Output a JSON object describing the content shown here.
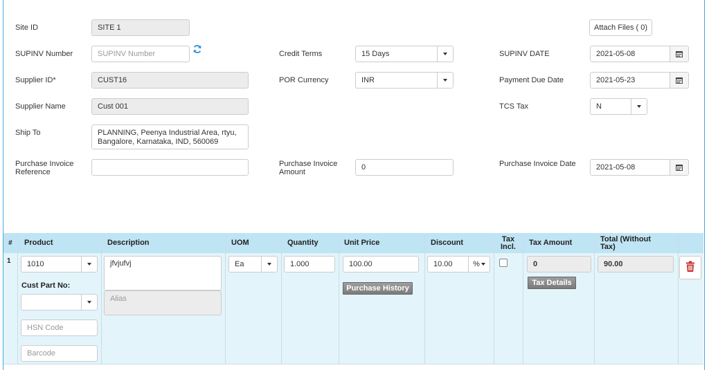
{
  "header": {
    "site_id_label": "Site ID",
    "site_id_value": "SITE 1",
    "attach_files_label": "Attach Files ( 0)",
    "supinv_number_label": "SUPINV Number",
    "supinv_number_placeholder": "SUPINV Number",
    "credit_terms_label": "Credit Terms",
    "credit_terms_value": "15 Days",
    "supinv_date_label": "SUPINV DATE",
    "supinv_date_value": "2021-05-08",
    "supplier_id_label": "Supplier ID*",
    "supplier_id_value": "CUST16",
    "por_currency_label": "POR Currency",
    "por_currency_value": "INR",
    "payment_due_date_label": "Payment Due Date",
    "payment_due_date_value": "2021-05-23",
    "supplier_name_label": "Supplier Name",
    "supplier_name_value": "Cust 001",
    "tcs_tax_label": "TCS Tax",
    "tcs_tax_value": "N",
    "ship_to_label": "Ship To",
    "ship_to_value": "PLANNING, Peenya Industrial Area, rtyu, Bangalore, Karnataka, IND, 560069",
    "purchase_invoice_reference_label": "Purchase Invoice Reference",
    "purchase_invoice_amount_label": "Purchase Invoice Amount",
    "purchase_invoice_amount_value": "0",
    "purchase_invoice_date_label": "Purchase Invoice Date",
    "purchase_invoice_date_value": "2021-05-08"
  },
  "grid": {
    "columns": [
      "#",
      "Product",
      "Description",
      "UOM",
      "Quantity",
      "Unit Price",
      "Discount",
      "Tax Incl.",
      "Tax Amount",
      "Total (Without Tax)"
    ],
    "row": {
      "index": "1",
      "product": "1010",
      "cust_part_no_label": "Cust Part No:",
      "cust_part_no_value": "",
      "hsn_code_placeholder": "HSN Code",
      "barcode_placeholder": "Barcode",
      "description": "jfvjufvj",
      "alias_placeholder": "Alias",
      "uom": "Ea",
      "quantity": "1.000",
      "unit_price": "100.00",
      "purchase_history_label": "Purchase History",
      "discount": "10.00",
      "discount_type": "%",
      "tax_incl": false,
      "tax_amount": "0",
      "tax_details_label": "Tax Details",
      "total": "90.00"
    }
  },
  "colors": {
    "frame_border": "#4aa7d9",
    "grid_header": "#bfe4f3",
    "grid_body": "#e3f4fb",
    "refresh_icon": "#2a8fd6",
    "delete_icon": "#c9302c"
  }
}
